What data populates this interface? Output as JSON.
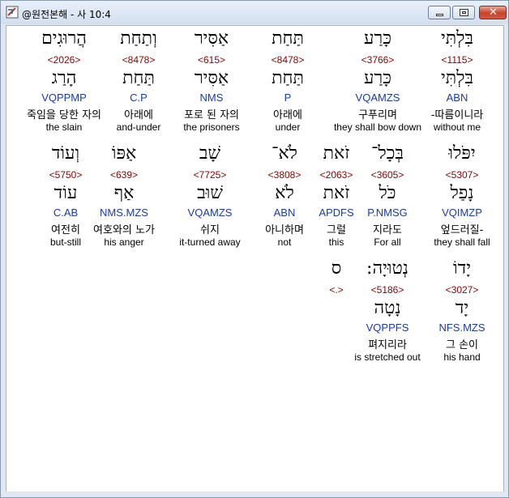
{
  "window": {
    "title": "@원전본해 - 사 10:4"
  },
  "entries": [
    {
      "heb": "בִּלְתִּי",
      "num": "<1115>",
      "lex": "בִּלְתִּי",
      "parse": "ABN",
      "kor": "-따름이니라",
      "eng": "without me"
    },
    {
      "heb": "כָּרַע",
      "num": "<3766>",
      "lex": "כָּרַע",
      "parse": "VQAMZS",
      "kor": "구푸리며",
      "eng": "they shall bow down"
    },
    {
      "heb": "תַּחַת",
      "num": "<8478>",
      "lex": "תַּחַת",
      "parse": "P",
      "kor": "아래에",
      "eng": "under"
    },
    {
      "heb": "אַסִּיר",
      "num": "<615>",
      "lex": "אַסִּיר",
      "parse": "NMS",
      "kor": "포로 된 자의",
      "eng": "the prisoners"
    },
    {
      "heb": "וְתַחַת",
      "num": "<8478>",
      "lex": "תַּחַת",
      "parse": "C.P",
      "kor": "아래에",
      "eng": "and-under"
    },
    {
      "heb": "הֲרוּגִים",
      "num": "<2026>",
      "lex": "הָרַג",
      "parse": "VQPPMP",
      "kor": "죽임을 당한 자의",
      "eng": "the slain"
    },
    {
      "heb": "יִפֹּלוּ",
      "num": "<5307>",
      "lex": "נָפַל",
      "parse": "VQIMZP",
      "kor": "엎드러질-",
      "eng": "they shall fall"
    },
    {
      "heb": "בְּכָל־",
      "num": "<3605>",
      "lex": "כֹּל",
      "parse": "P.NMSG",
      "kor": "지라도",
      "eng": "For all"
    },
    {
      "heb": "זֹאת",
      "num": "<2063>",
      "lex": "זֹאת",
      "parse": "APDFS",
      "kor": "그럴",
      "eng": "this"
    },
    {
      "heb": "לֹא־",
      "num": "<3808>",
      "lex": "לֹא",
      "parse": "ABN",
      "kor": "아니하며",
      "eng": "not"
    },
    {
      "heb": "שָׁב",
      "num": "<7725>",
      "lex": "שׁוּב",
      "parse": "VQAMZS",
      "kor": "쉬지",
      "eng": "it-turned away"
    },
    {
      "heb": "אַפּוֹ",
      "num": "<639>",
      "lex": "אַף",
      "parse": "NMS.MZS",
      "kor": "여호와의 노가",
      "eng": "his anger"
    },
    {
      "heb": "וְעוֹד",
      "num": "<5750>",
      "lex": "עוֹד",
      "parse": "C.AB",
      "kor": "여전히",
      "eng": "but-still"
    },
    {
      "heb": "יָדוֹ",
      "num": "<3027>",
      "lex": "יָד",
      "parse": "NFS.MZS",
      "kor": "그 손이",
      "eng": "his hand"
    },
    {
      "heb": "נְטוּיָה:",
      "num": "<5186>",
      "lex": "נָטָה",
      "parse": "VQPPFS",
      "kor": "펴지리라",
      "eng": "is stretched out"
    },
    {
      "heb": "ס",
      "num": "<.>",
      "lex": "",
      "parse": "",
      "kor": "",
      "eng": ""
    }
  ]
}
